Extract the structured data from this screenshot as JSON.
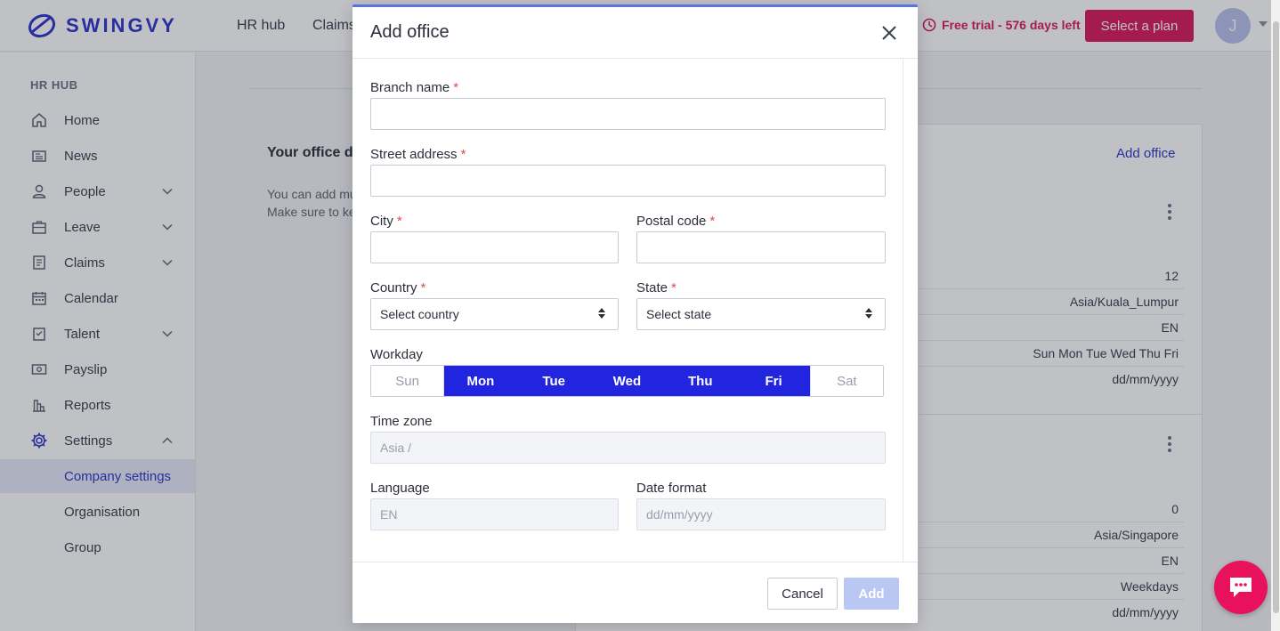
{
  "brand": {
    "name": "SWINGVY"
  },
  "topnav": {
    "tabs": [
      {
        "label": "HR hub"
      },
      {
        "label": "Claims"
      }
    ],
    "trial_text": "Free trial - 576 days left",
    "plan_button": "Select a plan",
    "avatar_initial": "J"
  },
  "sidebar": {
    "section": "HR HUB",
    "items": [
      {
        "label": "Home"
      },
      {
        "label": "News"
      },
      {
        "label": "People"
      },
      {
        "label": "Leave"
      },
      {
        "label": "Claims"
      },
      {
        "label": "Calendar"
      },
      {
        "label": "Talent"
      },
      {
        "label": "Payslip"
      },
      {
        "label": "Reports"
      },
      {
        "label": "Settings"
      }
    ],
    "sub_items": [
      {
        "label": "Company settings"
      },
      {
        "label": "Organisation"
      },
      {
        "label": "Group"
      }
    ]
  },
  "background": {
    "title": "Your office de",
    "desc_line1": "You can add mu",
    "desc_line2": "Make sure to ke",
    "add_office_link": "Add office",
    "office1": {
      "rows": [
        "12",
        "Asia/Kuala_Lumpur",
        "EN",
        "Sun Mon Tue Wed Thu Fri",
        "dd/mm/yyyy"
      ]
    },
    "office2": {
      "rows": [
        "0",
        "Asia/Singapore",
        "EN",
        "Weekdays",
        "dd/mm/yyyy"
      ]
    }
  },
  "modal": {
    "title": "Add office",
    "branch_label": "Branch name",
    "street_label": "Street address",
    "city_label": "City",
    "postal_label": "Postal code",
    "country_label": "Country",
    "country_value": "Select country",
    "state_label": "State",
    "state_value": "Select state",
    "workday_label": "Workday",
    "days": [
      {
        "label": "Sun",
        "selected": false
      },
      {
        "label": "Mon",
        "selected": true
      },
      {
        "label": "Tue",
        "selected": true
      },
      {
        "label": "Wed",
        "selected": true
      },
      {
        "label": "Thu",
        "selected": true
      },
      {
        "label": "Fri",
        "selected": true
      },
      {
        "label": "Sat",
        "selected": false
      }
    ],
    "timezone_label": "Time zone",
    "timezone_value": "Asia /",
    "language_label": "Language",
    "language_value": "EN",
    "dateformat_label": "Date format",
    "dateformat_value": "dd/mm/yyyy",
    "required_mark": "*",
    "cancel_button": "Cancel",
    "add_button": "Add"
  },
  "colors": {
    "brand": "#2d35c9",
    "accent_pink": "#d91b5c",
    "day_selected": "#2125e0",
    "add_disabled": "#b9c7f2"
  }
}
